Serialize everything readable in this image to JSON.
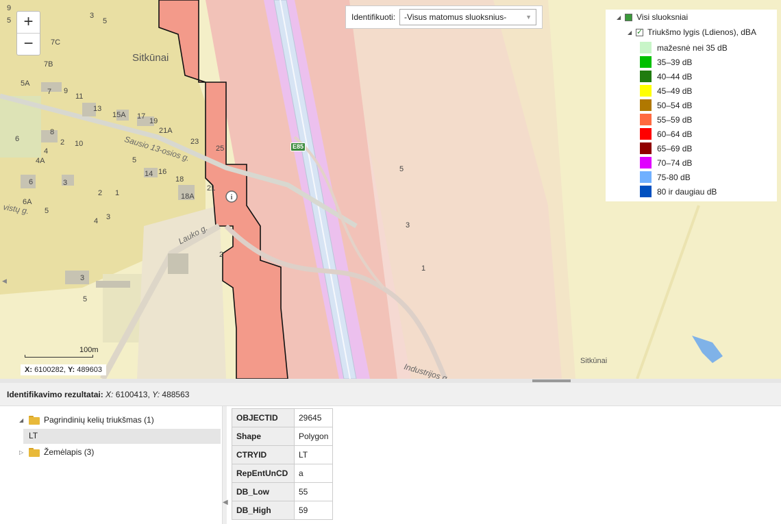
{
  "map": {
    "place_labels": [
      "Sitkūnai",
      "Sitkūnai"
    ],
    "street_labels": [
      "Sausio 13-osios g.",
      "Lauko g.",
      "Industrijos g.",
      "vistų g."
    ],
    "road_shield": "E85",
    "house_numbers": [
      "9",
      "5",
      "3",
      "5",
      "7C",
      "7B",
      "5A",
      "7",
      "9",
      "11",
      "13",
      "15A",
      "17",
      "19",
      "21A",
      "23",
      "25",
      "8",
      "6",
      "4",
      "4A",
      "2",
      "10",
      "5",
      "14",
      "16",
      "18",
      "21",
      "6",
      "3",
      "2",
      "1",
      "18A",
      "6A",
      "5",
      "4",
      "3",
      "2",
      "3",
      "5",
      "5",
      "3",
      "1"
    ],
    "zoom_in": "+",
    "zoom_out": "−",
    "identify_label": "Identifikuoti:",
    "identify_value": "-Visus matomus sluoksnius-",
    "scale_label": "100m",
    "coords_x_label": "X:",
    "coords_x": "6100282",
    "coords_y_label": "Y:",
    "coords_y": "489603",
    "colors": {
      "base": "#f4efc8",
      "residential": "#ece2a8",
      "noise_band_light": "#f5d6d0",
      "noise_band_mid": "#f0bdb5",
      "noise_band_selected": "#f28d7e",
      "highway": "#d6e4f2"
    }
  },
  "legend": {
    "root_label": "Visi sluoksniai",
    "layer_label": "Triukšmo lygis (Ldienos), dBA",
    "items": [
      {
        "label": "mažesnė nei 35 dB",
        "color": "#c8f5c8"
      },
      {
        "label": "35–39 dB",
        "color": "#00c000"
      },
      {
        "label": "40–44 dB",
        "color": "#207c10"
      },
      {
        "label": "45–49 dB",
        "color": "#ffff00"
      },
      {
        "label": "50–54 dB",
        "color": "#b07800"
      },
      {
        "label": "55–59 dB",
        "color": "#ff6a40"
      },
      {
        "label": "60–64 dB",
        "color": "#ff0000"
      },
      {
        "label": "65–69 dB",
        "color": "#900000"
      },
      {
        "label": "70–74 dB",
        "color": "#e000ff"
      },
      {
        "label": "75-80 dB",
        "color": "#70b0ff"
      },
      {
        "label": "80 ir daugiau dB",
        "color": "#0050c0"
      }
    ]
  },
  "results": {
    "title": "Identifikavimo rezultatai:",
    "x_label": "X:",
    "x_value": "6100413,",
    "y_label": "Y:",
    "y_value": "488563"
  },
  "tree": {
    "nodes": [
      {
        "label": "Pagrindinių kelių triukšmas (1)"
      },
      {
        "label": "LT"
      },
      {
        "label": "Žemėlapis (3)"
      }
    ]
  },
  "attributes": [
    {
      "key": "OBJECTID",
      "value": "29645"
    },
    {
      "key": "Shape",
      "value": "Polygon"
    },
    {
      "key": "CTRYID",
      "value": "LT"
    },
    {
      "key": "RepEntUnCD",
      "value": "a"
    },
    {
      "key": "DB_Low",
      "value": "55"
    },
    {
      "key": "DB_High",
      "value": "59"
    }
  ]
}
